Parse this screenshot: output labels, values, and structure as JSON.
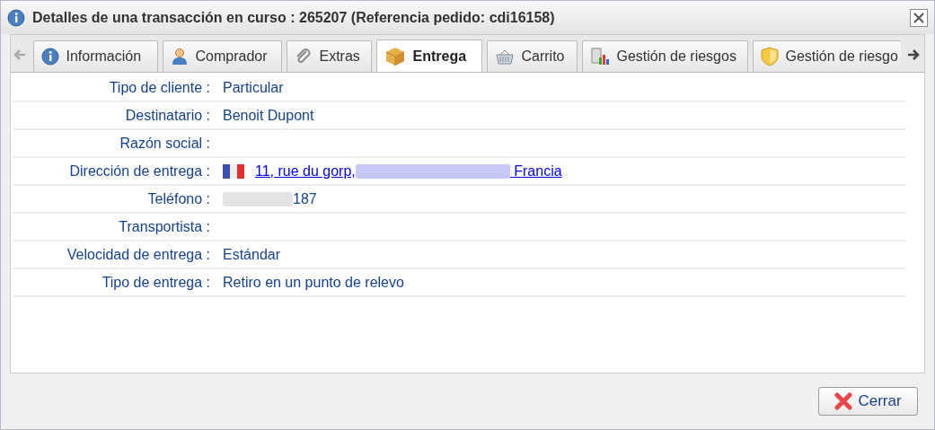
{
  "window": {
    "title": "Detalles de una transacción en curso : 265207 (Referencia pedido: cdi16158)"
  },
  "tabs": [
    {
      "label": "Información",
      "selected": false
    },
    {
      "label": "Comprador",
      "selected": false
    },
    {
      "label": "Extras",
      "selected": false
    },
    {
      "label": "Entrega",
      "selected": true
    },
    {
      "label": "Carrito",
      "selected": false
    },
    {
      "label": "Gestión de riesgos",
      "selected": false
    },
    {
      "label": "Gestión de riesgo",
      "selected": false
    }
  ],
  "fields": [
    {
      "label": "Tipo de cliente :",
      "kind": "text",
      "value": "Particular"
    },
    {
      "label": "Destinatario :",
      "kind": "text",
      "value": "Benoit Dupont"
    },
    {
      "label": "Razón social :",
      "kind": "empty"
    },
    {
      "label": "Dirección de entrega :",
      "kind": "address",
      "value": "11, rue du gorp,",
      "value_end": " Francia"
    },
    {
      "label": "Teléfono :",
      "kind": "phone",
      "value": "187"
    },
    {
      "label": "Transportista :",
      "kind": "empty"
    },
    {
      "label": "Velocidad de entrega :",
      "kind": "text",
      "value": "Estándar"
    },
    {
      "label": "Tipo de entrega :",
      "kind": "text",
      "value": "Retiro en un punto de relevo"
    }
  ],
  "buttons": [
    {
      "label": "Cerrar"
    }
  ]
}
